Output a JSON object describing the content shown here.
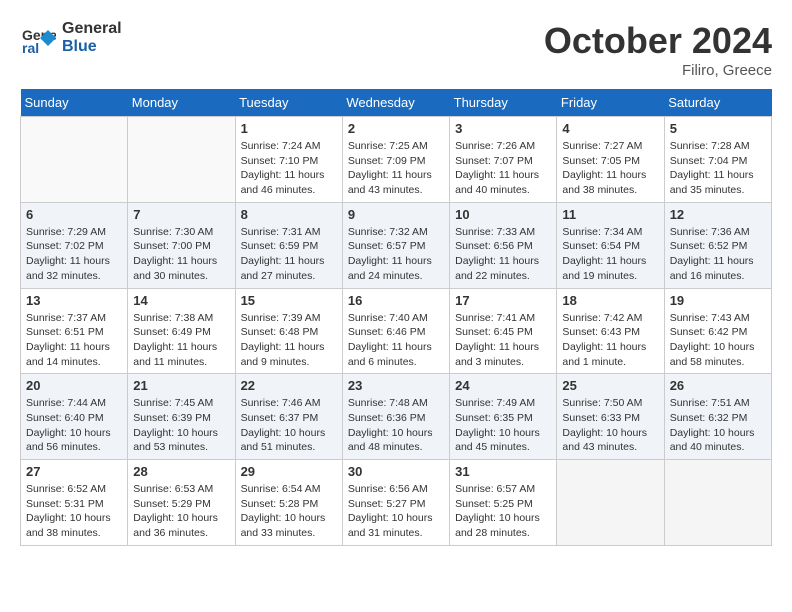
{
  "header": {
    "logo_line1": "General",
    "logo_line2": "Blue",
    "month": "October 2024",
    "location": "Filiro, Greece"
  },
  "days_of_week": [
    "Sunday",
    "Monday",
    "Tuesday",
    "Wednesday",
    "Thursday",
    "Friday",
    "Saturday"
  ],
  "weeks": [
    [
      {
        "day": "",
        "info": ""
      },
      {
        "day": "",
        "info": ""
      },
      {
        "day": "1",
        "info": "Sunrise: 7:24 AM\nSunset: 7:10 PM\nDaylight: 11 hours and 46 minutes."
      },
      {
        "day": "2",
        "info": "Sunrise: 7:25 AM\nSunset: 7:09 PM\nDaylight: 11 hours and 43 minutes."
      },
      {
        "day": "3",
        "info": "Sunrise: 7:26 AM\nSunset: 7:07 PM\nDaylight: 11 hours and 40 minutes."
      },
      {
        "day": "4",
        "info": "Sunrise: 7:27 AM\nSunset: 7:05 PM\nDaylight: 11 hours and 38 minutes."
      },
      {
        "day": "5",
        "info": "Sunrise: 7:28 AM\nSunset: 7:04 PM\nDaylight: 11 hours and 35 minutes."
      }
    ],
    [
      {
        "day": "6",
        "info": "Sunrise: 7:29 AM\nSunset: 7:02 PM\nDaylight: 11 hours and 32 minutes."
      },
      {
        "day": "7",
        "info": "Sunrise: 7:30 AM\nSunset: 7:00 PM\nDaylight: 11 hours and 30 minutes."
      },
      {
        "day": "8",
        "info": "Sunrise: 7:31 AM\nSunset: 6:59 PM\nDaylight: 11 hours and 27 minutes."
      },
      {
        "day": "9",
        "info": "Sunrise: 7:32 AM\nSunset: 6:57 PM\nDaylight: 11 hours and 24 minutes."
      },
      {
        "day": "10",
        "info": "Sunrise: 7:33 AM\nSunset: 6:56 PM\nDaylight: 11 hours and 22 minutes."
      },
      {
        "day": "11",
        "info": "Sunrise: 7:34 AM\nSunset: 6:54 PM\nDaylight: 11 hours and 19 minutes."
      },
      {
        "day": "12",
        "info": "Sunrise: 7:36 AM\nSunset: 6:52 PM\nDaylight: 11 hours and 16 minutes."
      }
    ],
    [
      {
        "day": "13",
        "info": "Sunrise: 7:37 AM\nSunset: 6:51 PM\nDaylight: 11 hours and 14 minutes."
      },
      {
        "day": "14",
        "info": "Sunrise: 7:38 AM\nSunset: 6:49 PM\nDaylight: 11 hours and 11 minutes."
      },
      {
        "day": "15",
        "info": "Sunrise: 7:39 AM\nSunset: 6:48 PM\nDaylight: 11 hours and 9 minutes."
      },
      {
        "day": "16",
        "info": "Sunrise: 7:40 AM\nSunset: 6:46 PM\nDaylight: 11 hours and 6 minutes."
      },
      {
        "day": "17",
        "info": "Sunrise: 7:41 AM\nSunset: 6:45 PM\nDaylight: 11 hours and 3 minutes."
      },
      {
        "day": "18",
        "info": "Sunrise: 7:42 AM\nSunset: 6:43 PM\nDaylight: 11 hours and 1 minute."
      },
      {
        "day": "19",
        "info": "Sunrise: 7:43 AM\nSunset: 6:42 PM\nDaylight: 10 hours and 58 minutes."
      }
    ],
    [
      {
        "day": "20",
        "info": "Sunrise: 7:44 AM\nSunset: 6:40 PM\nDaylight: 10 hours and 56 minutes."
      },
      {
        "day": "21",
        "info": "Sunrise: 7:45 AM\nSunset: 6:39 PM\nDaylight: 10 hours and 53 minutes."
      },
      {
        "day": "22",
        "info": "Sunrise: 7:46 AM\nSunset: 6:37 PM\nDaylight: 10 hours and 51 minutes."
      },
      {
        "day": "23",
        "info": "Sunrise: 7:48 AM\nSunset: 6:36 PM\nDaylight: 10 hours and 48 minutes."
      },
      {
        "day": "24",
        "info": "Sunrise: 7:49 AM\nSunset: 6:35 PM\nDaylight: 10 hours and 45 minutes."
      },
      {
        "day": "25",
        "info": "Sunrise: 7:50 AM\nSunset: 6:33 PM\nDaylight: 10 hours and 43 minutes."
      },
      {
        "day": "26",
        "info": "Sunrise: 7:51 AM\nSunset: 6:32 PM\nDaylight: 10 hours and 40 minutes."
      }
    ],
    [
      {
        "day": "27",
        "info": "Sunrise: 6:52 AM\nSunset: 5:31 PM\nDaylight: 10 hours and 38 minutes."
      },
      {
        "day": "28",
        "info": "Sunrise: 6:53 AM\nSunset: 5:29 PM\nDaylight: 10 hours and 36 minutes."
      },
      {
        "day": "29",
        "info": "Sunrise: 6:54 AM\nSunset: 5:28 PM\nDaylight: 10 hours and 33 minutes."
      },
      {
        "day": "30",
        "info": "Sunrise: 6:56 AM\nSunset: 5:27 PM\nDaylight: 10 hours and 31 minutes."
      },
      {
        "day": "31",
        "info": "Sunrise: 6:57 AM\nSunset: 5:25 PM\nDaylight: 10 hours and 28 minutes."
      },
      {
        "day": "",
        "info": ""
      },
      {
        "day": "",
        "info": ""
      }
    ]
  ]
}
